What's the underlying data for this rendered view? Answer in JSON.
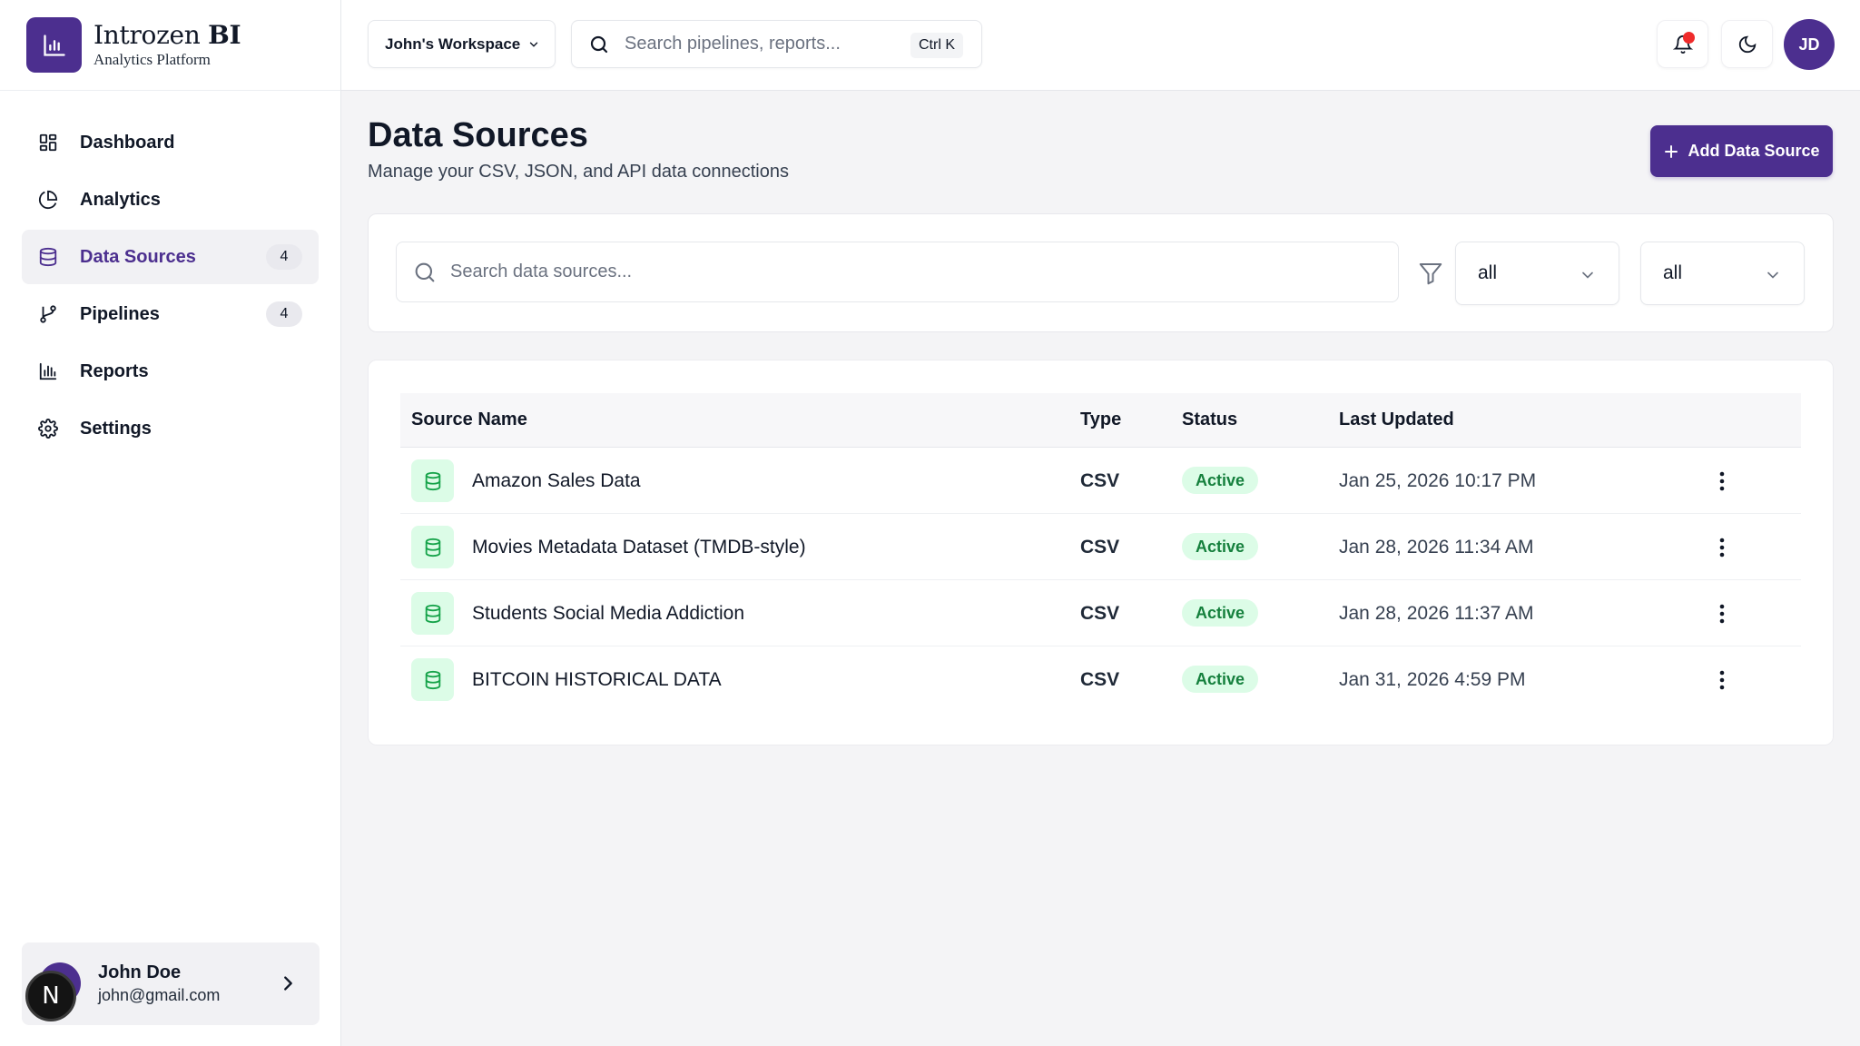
{
  "brand": {
    "name_regular": "Introzen ",
    "name_bold": "BI",
    "subtitle": "Analytics Platform"
  },
  "sidebar": {
    "items": [
      {
        "label": "Dashboard",
        "icon": "dashboard-grid-icon",
        "badge": null
      },
      {
        "label": "Analytics",
        "icon": "pie-chart-icon",
        "badge": null
      },
      {
        "label": "Data Sources",
        "icon": "database-icon",
        "badge": "4",
        "active": true
      },
      {
        "label": "Pipelines",
        "icon": "git-branch-icon",
        "badge": "4"
      },
      {
        "label": "Reports",
        "icon": "bar-chart-icon",
        "badge": null
      },
      {
        "label": "Settings",
        "icon": "gear-icon",
        "badge": null
      }
    ],
    "user": {
      "name": "John Doe",
      "email": "john@gmail.com",
      "badge_letter": "N"
    }
  },
  "topbar": {
    "workspace": "John's Workspace",
    "search_placeholder": "Search pipelines, reports...",
    "shortcut": "Ctrl K",
    "avatar_initials": "JD"
  },
  "page": {
    "title": "Data Sources",
    "subtitle": "Manage your CSV, JSON, and API data connections",
    "add_button": "Add Data Source"
  },
  "filters": {
    "search_placeholder": "Search data sources...",
    "type_select": "all",
    "status_select": "all"
  },
  "table": {
    "headers": {
      "name": "Source Name",
      "type": "Type",
      "status": "Status",
      "updated": "Last Updated"
    },
    "rows": [
      {
        "name": "Amazon Sales Data",
        "type": "CSV",
        "status": "Active",
        "updated": "Jan 25, 2026 10:17 PM"
      },
      {
        "name": "Movies Metadata Dataset (TMDB-style)",
        "type": "CSV",
        "status": "Active",
        "updated": "Jan 28, 2026 11:34 AM"
      },
      {
        "name": "Students Social Media Addiction",
        "type": "CSV",
        "status": "Active",
        "updated": "Jan 28, 2026 11:37 AM"
      },
      {
        "name": "BITCOIN HISTORICAL DATA",
        "type": "CSV",
        "status": "Active",
        "updated": "Jan 31, 2026 4:59 PM"
      }
    ]
  },
  "colors": {
    "accent": "#4c2f8f",
    "status_active_bg": "#dcfce7",
    "status_active_text": "#15803d",
    "notification": "#ef2b2b"
  }
}
